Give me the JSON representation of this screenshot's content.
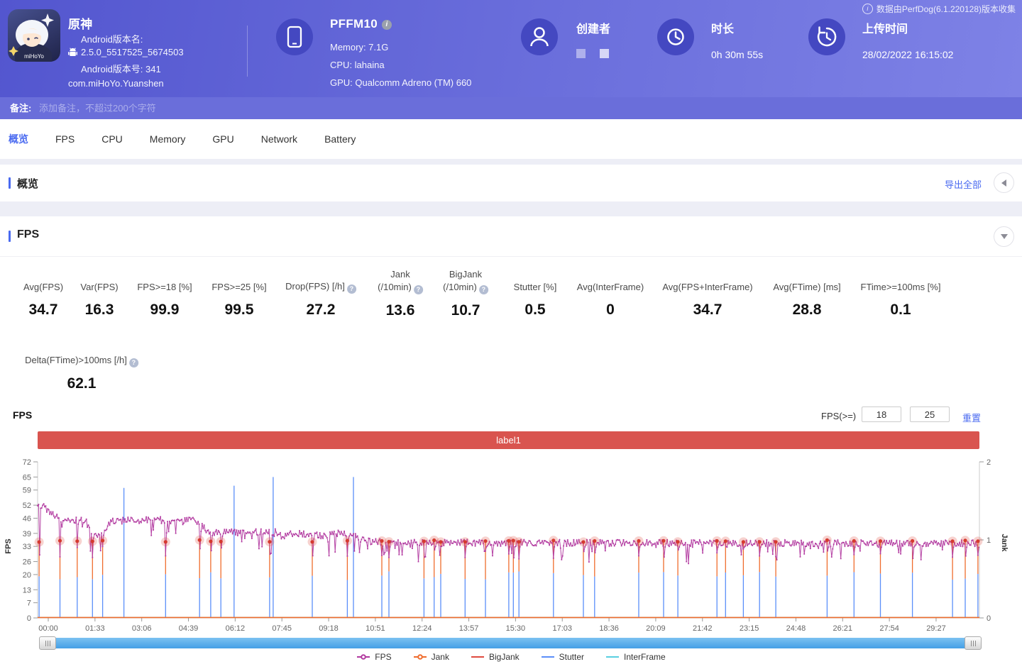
{
  "theme": {
    "accent_blue": "#4a6af0",
    "header_purple": "#5356cf",
    "banner_red": "#d9544f"
  },
  "top_note": {
    "text": "数据由PerfDog(6.1.220128)版本收集"
  },
  "header": {
    "game": {
      "title": "原神",
      "icon_caption": "miHoYo",
      "android_version_label": "Android版本名:",
      "android_version": "2.5.0_5517525_5674503",
      "android_build": "Android版本号: 341",
      "package": "com.miHoYo.Yuanshen"
    },
    "device": {
      "name": "PFFM10",
      "memory": "Memory: 7.1G",
      "cpu": "CPU: lahaina",
      "gpu": "GPU: Qualcomm Adreno (TM) 660"
    },
    "creator": {
      "label": "创建者"
    },
    "duration": {
      "label": "时长",
      "value": "0h 30m 55s"
    },
    "upload": {
      "label": "上传时间",
      "value": "28/02/2022 16:15:02"
    }
  },
  "note_bar": {
    "label": "备注:",
    "placeholder": "添加备注，不超过200个字符"
  },
  "tabs": [
    {
      "label": "概览",
      "active": true
    },
    {
      "label": "FPS",
      "active": false
    },
    {
      "label": "CPU",
      "active": false
    },
    {
      "label": "Memory",
      "active": false
    },
    {
      "label": "GPU",
      "active": false
    },
    {
      "label": "Network",
      "active": false
    },
    {
      "label": "Battery",
      "active": false
    }
  ],
  "overview": {
    "title": "概览",
    "export_label": "导出全部"
  },
  "fps_section": {
    "title": "FPS",
    "stats": [
      {
        "label": "Avg(FPS)",
        "value": "34.7",
        "help": false
      },
      {
        "label": "Var(FPS)",
        "value": "16.3",
        "help": false
      },
      {
        "label": "FPS>=18 [%]",
        "value": "99.9",
        "help": false
      },
      {
        "label": "FPS>=25 [%]",
        "value": "99.5",
        "help": false
      },
      {
        "label": "Drop(FPS) [/h]",
        "value": "27.2",
        "help": true
      },
      {
        "label": "Jank",
        "label2": "(/10min)",
        "value": "13.6",
        "help": true
      },
      {
        "label": "BigJank",
        "label2": "(/10min)",
        "value": "10.7",
        "help": true
      },
      {
        "label": "Stutter [%]",
        "value": "0.5",
        "help": false
      },
      {
        "label": "Avg(InterFrame)",
        "value": "0",
        "help": false
      },
      {
        "label": "Avg(FPS+InterFrame)",
        "value": "34.7",
        "help": false
      },
      {
        "label": "Avg(FTime) [ms]",
        "value": "28.8",
        "help": false
      },
      {
        "label": "FTime>=100ms [%]",
        "value": "0.1",
        "help": false
      }
    ],
    "stats_row2": [
      {
        "label": "Delta(FTime)>100ms [/h]",
        "value": "62.1",
        "help": true
      }
    ],
    "chart_controls": {
      "chart_title": "FPS",
      "filter_label": "FPS(>=)",
      "threshold1": "18",
      "threshold2": "25",
      "reset_label": "重置"
    }
  },
  "chart_data": {
    "type": "line",
    "title": "FPS",
    "banner": {
      "text": "label1",
      "color": "#d9544f"
    },
    "duration_seconds": 1855,
    "x_ticks": [
      "00:00",
      "01:33",
      "03:06",
      "04:39",
      "06:12",
      "07:45",
      "09:18",
      "10:51",
      "12:24",
      "13:57",
      "15:30",
      "17:03",
      "18:36",
      "20:09",
      "21:42",
      "23:15",
      "24:48",
      "26:21",
      "27:54",
      "29:27"
    ],
    "x_tick_interval_seconds": 93,
    "y_left": {
      "label": "FPS",
      "ticks": [
        72,
        65,
        59,
        52,
        46,
        39,
        33,
        26,
        20,
        13,
        7,
        0
      ],
      "max": 72
    },
    "y_right": {
      "label": "Jank",
      "ticks": [
        2,
        1,
        0
      ],
      "max": 2
    },
    "legend": [
      {
        "name": "FPS",
        "color": "#b23aa0",
        "marker": true
      },
      {
        "name": "Jank",
        "color": "#ef6c2d",
        "marker": true
      },
      {
        "name": "BigJank",
        "color": "#df4b40",
        "marker": false
      },
      {
        "name": "Stutter",
        "color": "#5b8ff9",
        "marker": false
      },
      {
        "name": "InterFrame",
        "color": "#59cfe0",
        "marker": false
      }
    ],
    "fps_baseline": [
      [
        0,
        52
      ],
      [
        5,
        53
      ],
      [
        18,
        50
      ],
      [
        40,
        46.5
      ],
      [
        60,
        45.5
      ],
      [
        95,
        45
      ],
      [
        105,
        39
      ],
      [
        118,
        38
      ],
      [
        132,
        41
      ],
      [
        142,
        44.5
      ],
      [
        155,
        45
      ],
      [
        250,
        45.3
      ],
      [
        318,
        45
      ],
      [
        332,
        40.5
      ],
      [
        345,
        39.7
      ],
      [
        470,
        39.7
      ],
      [
        483,
        37.5
      ],
      [
        505,
        39.3
      ],
      [
        555,
        38
      ],
      [
        600,
        39.2
      ],
      [
        640,
        36.5
      ],
      [
        662,
        35.2
      ],
      [
        900,
        34.8
      ],
      [
        1855,
        34.6
      ]
    ],
    "noise_amplitude": 1.6,
    "dip_regions": [
      [
        95,
        140
      ],
      [
        220,
        255
      ],
      [
        300,
        330
      ],
      [
        420,
        470
      ],
      [
        560,
        670
      ],
      [
        690,
        770
      ],
      [
        1030,
        1100
      ],
      [
        1170,
        1290
      ],
      [
        1410,
        1500
      ],
      [
        1520,
        1590
      ],
      [
        1715,
        1750
      ],
      [
        1830,
        1855
      ]
    ],
    "jank_spikes_seconds": [
      3,
      44,
      78,
      108,
      128,
      252,
      319,
      341,
      361,
      457,
      541,
      610,
      678,
      692,
      761,
      781,
      794,
      842,
      882,
      928,
      937,
      948,
      1016,
      1075,
      1097,
      1184,
      1233,
      1261,
      1338,
      1355,
      1390,
      1422,
      1454,
      1555,
      1608,
      1660,
      1723,
      1802,
      1827,
      1852
    ],
    "stutter_up_spikes": [
      [
        170,
        60
      ],
      [
        387,
        61
      ],
      [
        464,
        65
      ],
      [
        622,
        65
      ]
    ],
    "avg_fps": 34.7
  }
}
